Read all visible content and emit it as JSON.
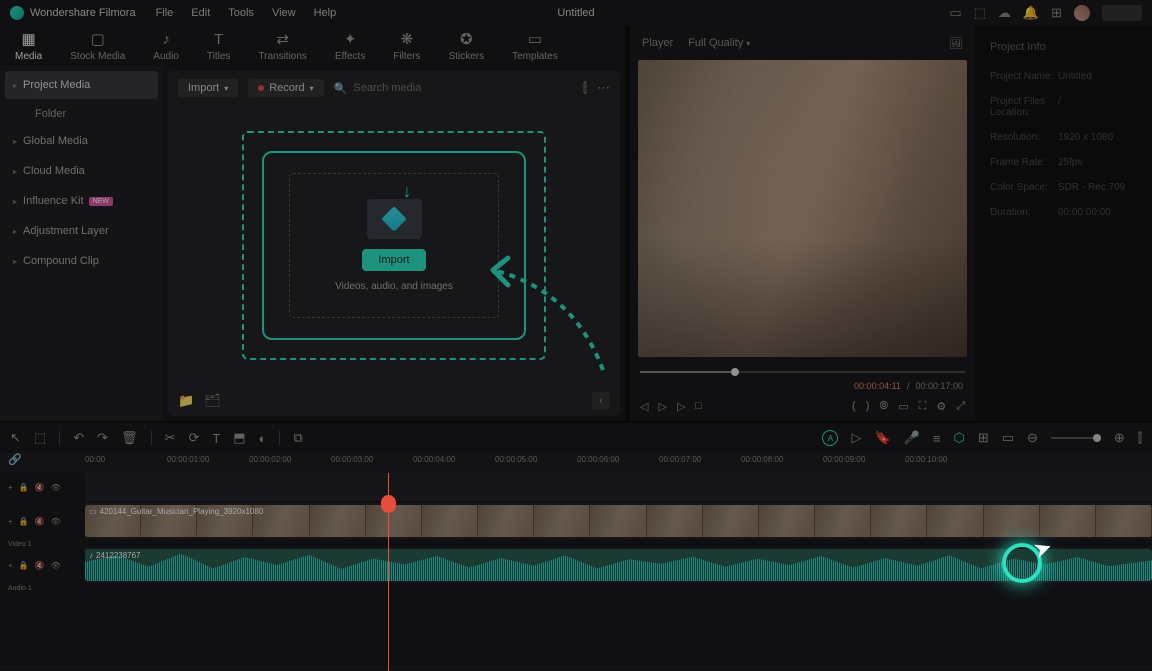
{
  "app": {
    "name": "Wondershare Filmora",
    "title": "Untitled"
  },
  "menu": [
    "File",
    "Edit",
    "Tools",
    "View",
    "Help"
  ],
  "tabs": [
    {
      "label": "Media",
      "icon": "▦"
    },
    {
      "label": "Stock Media",
      "icon": "▢"
    },
    {
      "label": "Audio",
      "icon": "♪"
    },
    {
      "label": "Titles",
      "icon": "T"
    },
    {
      "label": "Transitions",
      "icon": "⇄"
    },
    {
      "label": "Effects",
      "icon": "✦"
    },
    {
      "label": "Filters",
      "icon": "❋"
    },
    {
      "label": "Stickers",
      "icon": "✪"
    },
    {
      "label": "Templates",
      "icon": "▭"
    }
  ],
  "sidebar": {
    "items": [
      {
        "label": "Project Media",
        "active": true
      },
      {
        "label": "Global Media"
      },
      {
        "label": "Cloud Media"
      },
      {
        "label": "Influence Kit",
        "badge": "NEW"
      },
      {
        "label": "Adjustment Layer"
      },
      {
        "label": "Compound Clip"
      }
    ],
    "folder_label": "Folder"
  },
  "media_toolbar": {
    "import": "Import",
    "record": "Record",
    "search_placeholder": "Search media"
  },
  "import_zone": {
    "button": "Import",
    "subtitle": "Videos, audio, and images"
  },
  "preview": {
    "player_label": "Player",
    "quality": "Full Quality",
    "current_time": "00:00:04:11",
    "total_time": "00:00:17:00"
  },
  "project_info": {
    "title": "Project Info",
    "rows": [
      {
        "label": "Project Name:",
        "value": "Untitled"
      },
      {
        "label": "Project Files Location:",
        "value": "/"
      },
      {
        "label": "Resolution:",
        "value": "1920 x 1080"
      },
      {
        "label": "Frame Rate:",
        "value": "25fps"
      },
      {
        "label": "Color Space:",
        "value": "SDR - Rec.709"
      },
      {
        "label": "Duration:",
        "value": "00:00:00:00"
      }
    ]
  },
  "timeline": {
    "ticks": [
      "00:00",
      "00:00:01:00",
      "00:00:02:00",
      "00:00:03:00",
      "00:00:04:00",
      "00:00:05:00",
      "00:00:06:00",
      "00:00:07:00",
      "00:00:08:00",
      "00:00:09:00",
      "00:00:10:00"
    ],
    "video_label": "Video 1",
    "audio_label": "Audio 1",
    "video_clip_name": "420144_Guitar_Musician_Playing_3920x1080",
    "audio_clip_name": "2412238767"
  }
}
